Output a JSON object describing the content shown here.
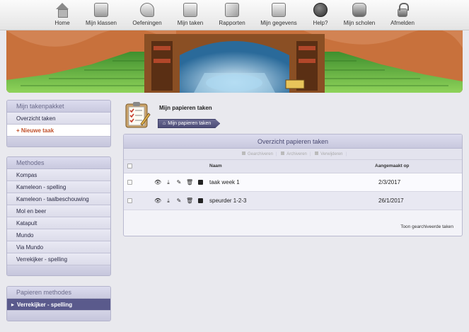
{
  "nav": [
    {
      "label": "Home",
      "icon": "home-icon"
    },
    {
      "label": "Mijn klassen",
      "icon": "classes-icon"
    },
    {
      "label": "Oefeningen",
      "icon": "exercises-icon"
    },
    {
      "label": "Mijn taken",
      "icon": "tasks-icon"
    },
    {
      "label": "Rapporten",
      "icon": "reports-icon"
    },
    {
      "label": "Mijn gegevens",
      "icon": "profile-icon"
    },
    {
      "label": "Help?",
      "icon": "help-icon"
    },
    {
      "label": "Mijn scholen",
      "icon": "schools-icon"
    },
    {
      "label": "Afmelden",
      "icon": "lock-icon"
    }
  ],
  "sidebar": {
    "takenpakket": {
      "title": "Mijn takenpakket",
      "items": [
        "Overzicht taken",
        "+ Nieuwe taak"
      ]
    },
    "methodes": {
      "title": "Methodes",
      "items": [
        "Kompas",
        "Kameleon - spelling",
        "Kameleon - taalbeschouwing",
        "Mol en beer",
        "Katapult",
        "Mundo",
        "Via Mundo",
        "Verrekijker - spelling"
      ]
    },
    "papieren_methodes": {
      "title": "Papieren methodes",
      "items": [
        "Verrekijker - spelling"
      ]
    }
  },
  "main": {
    "title": "Mijn papieren taken",
    "breadcrumb": "Mijn papieren taken",
    "box_title": "Overzicht papieren taken",
    "toolbar": [
      "Gearchiveren",
      "Archiveren",
      "Verwijderen"
    ],
    "columns": {
      "name": "Naam",
      "created": "Aangemaakt op"
    },
    "rows": [
      {
        "name": "taak week 1",
        "created": "2/3/2017"
      },
      {
        "name": "speurder 1-2-3",
        "created": "26/1/2017"
      }
    ],
    "footer_link": "Toon gearchiveerde taken"
  },
  "colors": {
    "accent": "#5a5a8c",
    "new_task": "#c0502a",
    "panel": "#d6d6e8"
  }
}
